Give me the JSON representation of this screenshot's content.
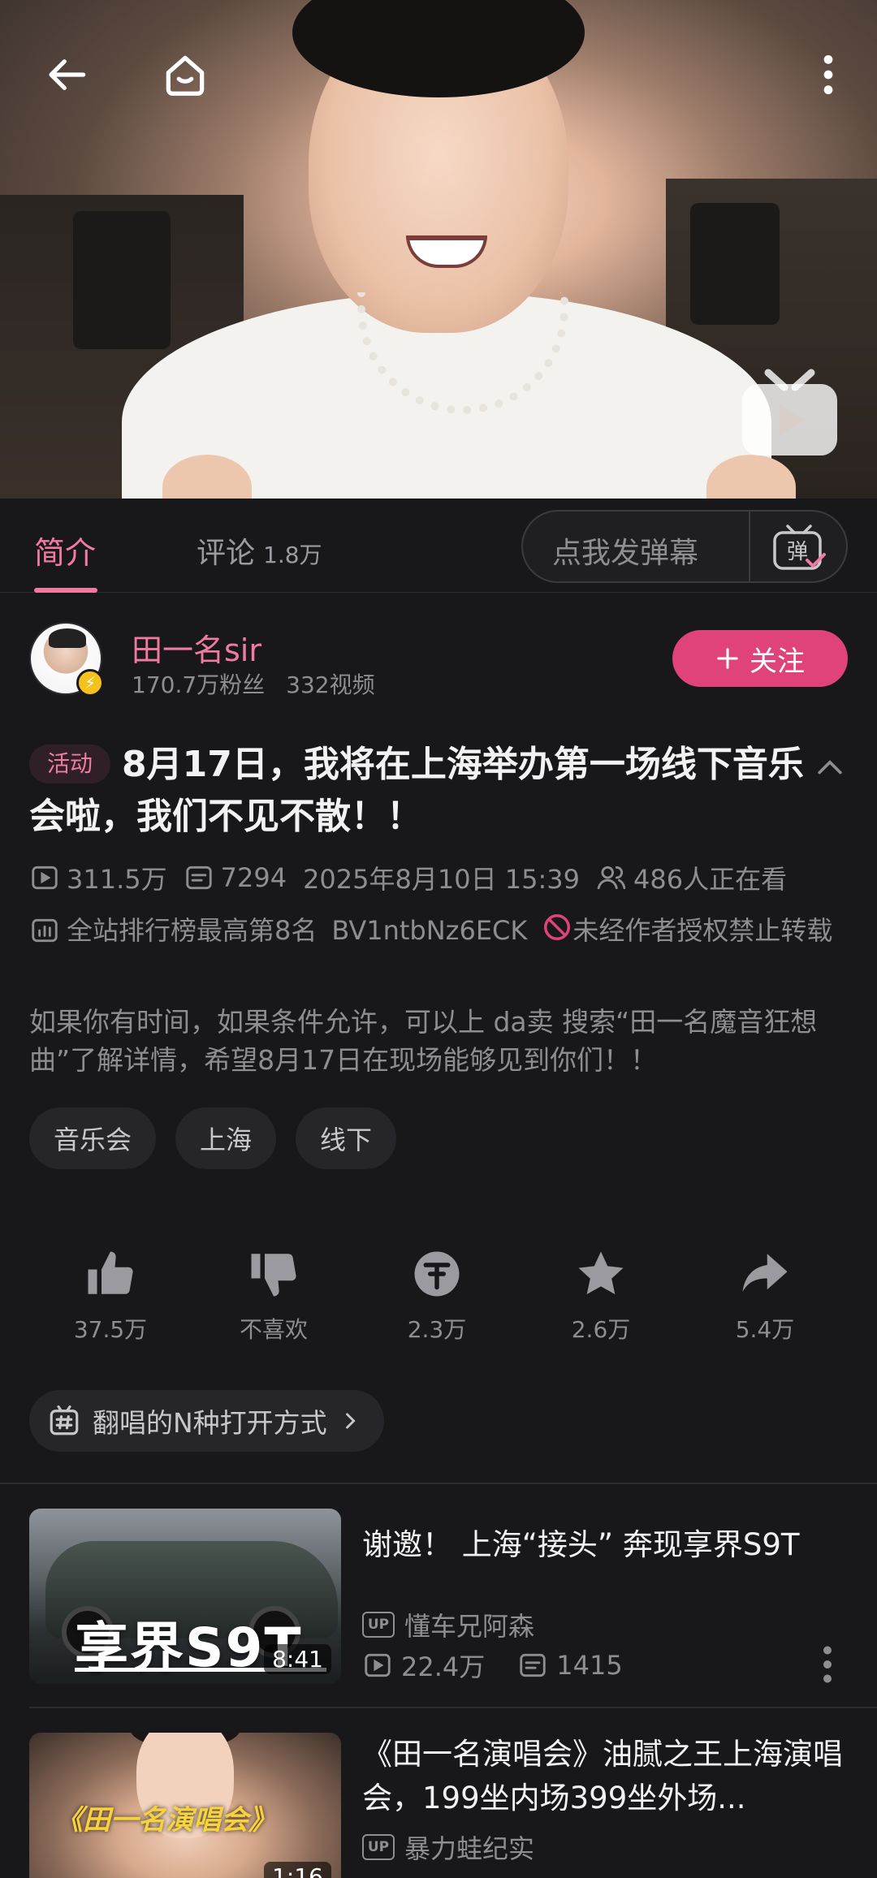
{
  "tabs": {
    "intro": "简介",
    "comments": "评论",
    "comments_count": "1.8万",
    "danmaku_placeholder": "点我发弹幕"
  },
  "uploader": {
    "name": "田一名sir",
    "fans": "170.7万粉丝",
    "videos": "332视频",
    "follow": "关注"
  },
  "video": {
    "tag": "活动",
    "title": "8月17日，我将在上海举办第一场线下音乐会啦，我们不见不散！！",
    "views": "311.5万",
    "danmaku": "7294",
    "date": "2025年8月10日 15:39",
    "watching": "486人正在看",
    "ranking": "全站排行榜最高第8名",
    "bvid": "BV1ntbNz6ECK",
    "copyright": "未经作者授权禁止转载",
    "description": "如果你有时间，如果条件允许，可以上 da卖 搜索“田一名魔音狂想曲”了解详情，希望8月17日在现场能够见到你们！！",
    "tags": [
      "音乐会",
      "上海",
      "线下"
    ]
  },
  "actions": {
    "like": "37.5万",
    "dislike": "不喜欢",
    "coin": "2.3万",
    "favorite": "2.6万",
    "share": "5.4万"
  },
  "topic": "翻唱的N种打开方式",
  "related": [
    {
      "title": "谢邀！ 上海“接头” 奔现享界S9T",
      "thumb_text": "享界S9T",
      "duration": "8:41",
      "up": "懂车兄阿森",
      "views": "22.4万",
      "danmaku": "1415"
    },
    {
      "title": "《田一名演唱会》油腻之王上海演唱会，199坐内场399坐外场...",
      "thumb_text": "《田一名演唱会》",
      "duration": "1:16",
      "up": "暴力蛙纪实"
    }
  ]
}
